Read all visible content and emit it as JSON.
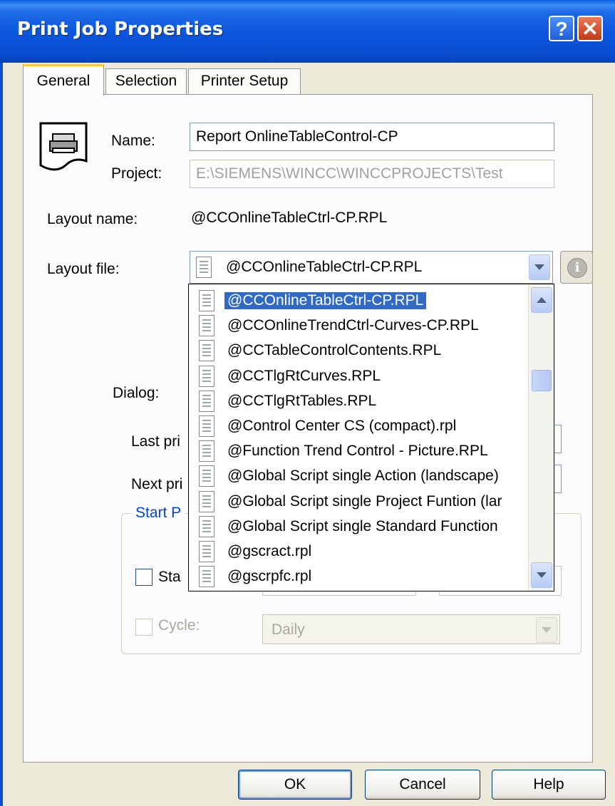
{
  "window": {
    "title": "Print Job Properties",
    "help_glyph": "?",
    "close_glyph": "✕"
  },
  "tabs": [
    {
      "label": "General",
      "active": true
    },
    {
      "label": "Selection",
      "active": false
    },
    {
      "label": "Printer Setup",
      "active": false
    }
  ],
  "general": {
    "name_label": "Name:",
    "name_value": "Report OnlineTableControl-CP",
    "project_label": "Project:",
    "project_value": "E:\\SIEMENS\\WINCC\\WINCCPROJECTS\\Test",
    "layout_name_label": "Layout name:",
    "layout_name_value": "@CCOnlineTableCtrl-CP.RPL",
    "layout_file_label": "Layout file:",
    "layout_file_value": "@CCOnlineTableCtrl-CP.RPL",
    "dialog_label": "Dialog:",
    "last_print_label": "Last pri",
    "next_print_label": "Next pri",
    "start_group_label": "Start P",
    "start_checkbox_label": "Sta",
    "cycle_label": "Cycle:",
    "cycle_value": "Daily"
  },
  "dropdown": {
    "items": [
      "@CCOnlineTableCtrl-CP.RPL",
      "@CCOnlineTrendCtrl-Curves-CP.RPL",
      "@CCTableControlContents.RPL",
      "@CCTlgRtCurves.RPL",
      "@CCTlgRtTables.RPL",
      "@Control Center CS (compact).rpl",
      "@Function Trend Control - Picture.RPL",
      "@Global Script single Action (landscape)",
      "@Global Script single Project Funtion (lar",
      "@Global Script single Standard Function",
      "@gscract.rpl",
      "@gscrpfc.rpl"
    ],
    "selected_index": 0
  },
  "buttons": {
    "ok": "OK",
    "cancel": "Cancel",
    "help": "Help"
  },
  "colors": {
    "titlebar": "#0a4fd2",
    "selection": "#316ac5",
    "dialog_bg": "#ece9d8",
    "group_title": "#0046d5"
  }
}
